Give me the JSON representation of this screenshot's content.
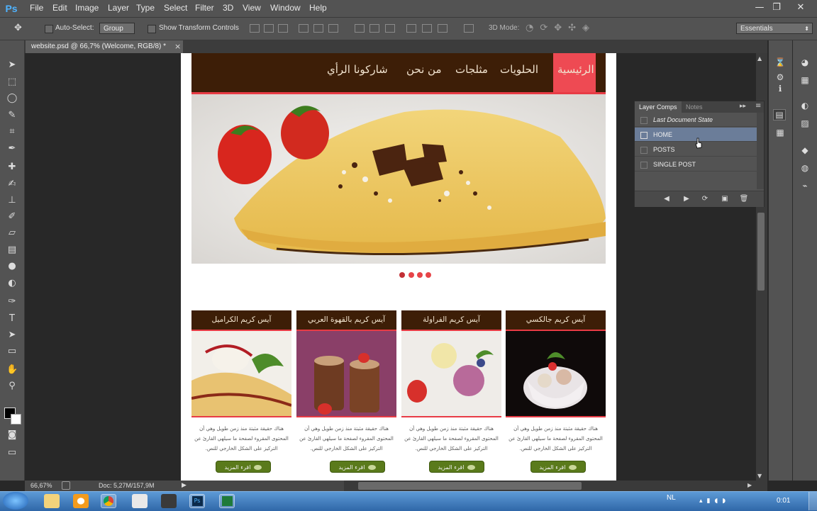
{
  "app": {
    "logo": "Ps"
  },
  "menu": [
    "File",
    "Edit",
    "Image",
    "Layer",
    "Type",
    "Select",
    "Filter",
    "3D",
    "View",
    "Window",
    "Help"
  ],
  "window_controls": {
    "minimize": "—",
    "restore": "❐",
    "close": "✕"
  },
  "options_bar": {
    "auto_select_label": "Auto-Select:",
    "auto_select_value": "Group",
    "transform_controls_label": "Show Transform Controls",
    "mode_3d_label": "3D Mode:",
    "workspace_value": "Essentials"
  },
  "document_tab": {
    "title": "website.psd @ 66,7% (Welcome, RGB/8) *",
    "close": "×"
  },
  "site": {
    "nav": [
      "الرئيسية",
      "الحلويات",
      "مثلجات",
      "من نحن",
      "شاركونا الرأي"
    ],
    "cards": [
      {
        "title": "آيس كريم جالكسي",
        "text": "هناك حقيقة مثبتة منذ زمن طويل وهي أن المحتوى المقروء لصفحة ما سيلهي القارئ عن التركيز على الشكل الخارجي للنص.",
        "button": "اقرء المزيد"
      },
      {
        "title": "آيس كريم الفراولة",
        "text": "هناك حقيقة مثبتة منذ زمن طويل وهي أن المحتوى المقروء لصفحة ما سيلهي القارئ عن التركيز على الشكل الخارجي للنص.",
        "button": "اقرء المزيد"
      },
      {
        "title": "آيس كريم بالقهوة العربي",
        "text": "هناك حقيقة مثبتة منذ زمن طويل وهي أن المحتوى المقروء لصفحة ما سيلهي القارئ عن التركيز على الشكل الخارجي للنص.",
        "button": "اقرء المزيد"
      },
      {
        "title": "آيس كريم الكراميل",
        "text": "هناك حقيقة مثبتة منذ زمن طويل وهي أن المحتوى المقروء لصفحة ما سيلهي القارئ عن التركيز على الشكل الخارجي للنص.",
        "button": "اقرء المزيد"
      }
    ],
    "colors": {
      "nav_bg": "#3d1e07",
      "accent": "#e83b45",
      "button": "#5a7a1b"
    }
  },
  "layer_comps": {
    "tabs": [
      "Layer Comps",
      "Notes"
    ],
    "rows": [
      "Last Document State",
      "HOME",
      "POSTS",
      "SINGLE POST"
    ],
    "selected": "HOME"
  },
  "status": {
    "zoom": "66,67%",
    "doc": "Doc: 5,27M/157,9M"
  },
  "taskbar": {
    "language": "NL",
    "clock": "0:01"
  }
}
